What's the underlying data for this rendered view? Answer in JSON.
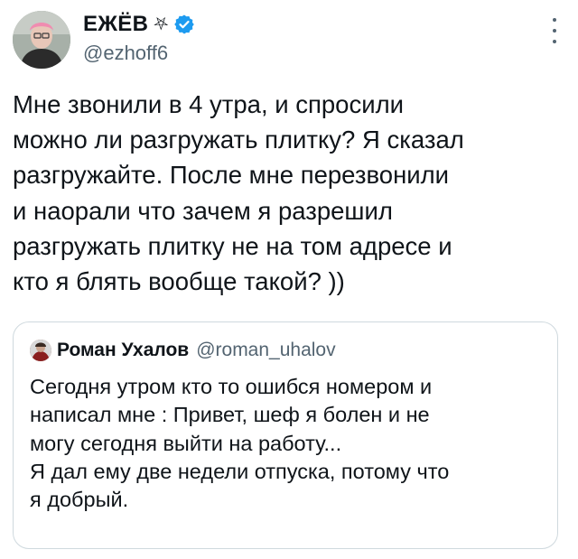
{
  "tweet": {
    "author": {
      "display_name": "ЕЖЁВ",
      "name_symbol": "⛧",
      "verified": true,
      "handle": "@ezhoff6"
    },
    "text": "Мне звонили в 4 утра, и спросили\nможно ли разгружать плитку? Я сказал\nразгружайте. После мне перезвонили\nи наорали что зачем я разрешил\nразгружать плитку не на том адресе и\nкто я блять вообще такой? ))"
  },
  "quoted_tweet": {
    "author": {
      "display_name": "Роман Ухалов",
      "handle": "@roman_uhalov"
    },
    "text": "Сегодня утром кто то ошибся номером и\nнаписал мне : Привет, шеф я болен и не\nмогу сегодня выйти на работу...\nЯ дал ему две недели отпуска, потому что\nя добрый."
  },
  "colors": {
    "text_primary": "#0f1419",
    "text_secondary": "#536471",
    "verified_blue": "#1d9bf0",
    "border": "#cfd9de"
  },
  "icons": {
    "verified": "verified-badge-icon",
    "more": "more-options-icon",
    "name_symbol": "pentagram-icon"
  }
}
